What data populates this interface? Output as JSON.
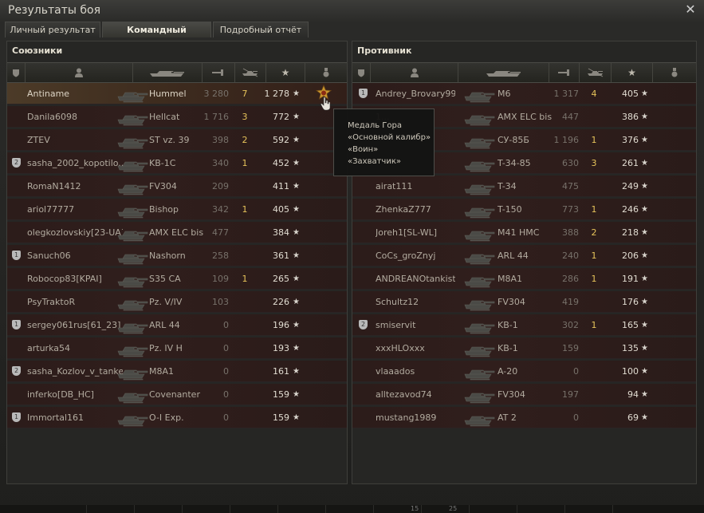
{
  "window": {
    "title": "Результаты боя"
  },
  "tabs": [
    {
      "label": "Личный результат",
      "active": false
    },
    {
      "label": "Командный результат",
      "active": true
    },
    {
      "label": "Подробный отчёт",
      "active": false
    }
  ],
  "allies": {
    "title": "Союзники",
    "rows": [
      {
        "badge": "",
        "name": "Antiname",
        "tank": "Hummel",
        "damage": "3 280",
        "kills": "7",
        "xp": "1 278",
        "self": true,
        "medal": true
      },
      {
        "badge": "",
        "name": "Danila6098",
        "tank": "Hellcat",
        "damage": "1 716",
        "kills": "3",
        "xp": "772"
      },
      {
        "badge": "",
        "name": "ZTEV",
        "tank": "ST vz. 39",
        "damage": "398",
        "kills": "2",
        "xp": "592"
      },
      {
        "badge": "2",
        "name": "sasha_2002_kopotilo..",
        "tank": "KB-1C",
        "damage": "340",
        "kills": "1",
        "xp": "452"
      },
      {
        "badge": "",
        "name": "RomaN1412",
        "tank": "FV304",
        "damage": "209",
        "kills": "",
        "xp": "411"
      },
      {
        "badge": "",
        "name": "ariol77777",
        "tank": "Bishop",
        "damage": "342",
        "kills": "1",
        "xp": "405"
      },
      {
        "badge": "",
        "name": "olegkozlovskiy[23-UA]",
        "tank": "AMX ELC bis",
        "damage": "477",
        "kills": "",
        "xp": "384"
      },
      {
        "badge": "1",
        "name": "Sanuch06",
        "tank": "Nashorn",
        "damage": "258",
        "kills": "",
        "xp": "361"
      },
      {
        "badge": "",
        "name": "Robocop83[KPAI]",
        "tank": "S35 CA",
        "damage": "109",
        "kills": "1",
        "xp": "265"
      },
      {
        "badge": "",
        "name": "PsyTraktoR",
        "tank": "Pz. V/IV",
        "damage": "103",
        "kills": "",
        "xp": "226"
      },
      {
        "badge": "1",
        "name": "sergey061rus[61_23]",
        "tank": "ARL 44",
        "damage": "0",
        "kills": "",
        "xp": "196"
      },
      {
        "badge": "",
        "name": "arturka54",
        "tank": "Pz. IV H",
        "damage": "0",
        "kills": "",
        "xp": "193"
      },
      {
        "badge": "2",
        "name": "sasha_Kozlov_v_tanke",
        "tank": "M8A1",
        "damage": "0",
        "kills": "",
        "xp": "161"
      },
      {
        "badge": "",
        "name": "inferko[DB_HC]",
        "tank": "Covenanter",
        "damage": "0",
        "kills": "",
        "xp": "159"
      },
      {
        "badge": "1",
        "name": "Immortal161",
        "tank": "O-I Exp.",
        "damage": "0",
        "kills": "",
        "xp": "159"
      }
    ]
  },
  "enemies": {
    "title": "Противник",
    "rows": [
      {
        "badge": "1",
        "name": "Andrey_Brovary99...",
        "tank": "M6",
        "damage": "1 317",
        "kills": "4",
        "xp": "405"
      },
      {
        "badge": "",
        "name": "1...",
        "tank": "AMX ELC bis",
        "damage": "447",
        "kills": "",
        "xp": "386"
      },
      {
        "badge": "",
        "name": "",
        "tank": "СУ-85Б",
        "damage": "1 196",
        "kills": "1",
        "xp": "376"
      },
      {
        "badge": "",
        "name": "",
        "tank": "T-34-85",
        "damage": "630",
        "kills": "3",
        "xp": "261"
      },
      {
        "badge": "",
        "name": "airat111",
        "tank": "T-34",
        "damage": "475",
        "kills": "",
        "xp": "249"
      },
      {
        "badge": "",
        "name": "ZhenkaZ777",
        "tank": "T-150",
        "damage": "773",
        "kills": "1",
        "xp": "246"
      },
      {
        "badge": "",
        "name": "Joreh1[SL-WL]",
        "tank": "M41 HMC",
        "damage": "388",
        "kills": "2",
        "xp": "218"
      },
      {
        "badge": "",
        "name": "CoCs_groZnyj",
        "tank": "ARL 44",
        "damage": "240",
        "kills": "1",
        "xp": "206"
      },
      {
        "badge": "",
        "name": "ANDREANOtankist",
        "tank": "M8A1",
        "damage": "286",
        "kills": "1",
        "xp": "191"
      },
      {
        "badge": "",
        "name": "Schultz12",
        "tank": "FV304",
        "damage": "419",
        "kills": "",
        "xp": "176"
      },
      {
        "badge": "2",
        "name": "smiservit",
        "tank": "KB-1",
        "damage": "302",
        "kills": "1",
        "xp": "165"
      },
      {
        "badge": "",
        "name": "xxxHLOxxx",
        "tank": "KB-1",
        "damage": "159",
        "kills": "",
        "xp": "135"
      },
      {
        "badge": "",
        "name": "vlaaados",
        "tank": "A-20",
        "damage": "0",
        "kills": "",
        "xp": "100"
      },
      {
        "badge": "",
        "name": "alltezavod74",
        "tank": "FV304",
        "damage": "197",
        "kills": "",
        "xp": "94"
      },
      {
        "badge": "",
        "name": "mustang1989",
        "tank": "AT 2",
        "damage": "0",
        "kills": "",
        "xp": "69"
      }
    ]
  },
  "tooltip": {
    "lines": [
      "Медаль Гора",
      "«Основной калибр»",
      "«Воин»",
      "«Захватчик»"
    ]
  },
  "icons": {
    "close": "close-icon",
    "star": "★",
    "shield": "badge-icon",
    "medal": "medal-icon"
  },
  "taskbar": {
    "items": [
      "15",
      "25"
    ]
  }
}
